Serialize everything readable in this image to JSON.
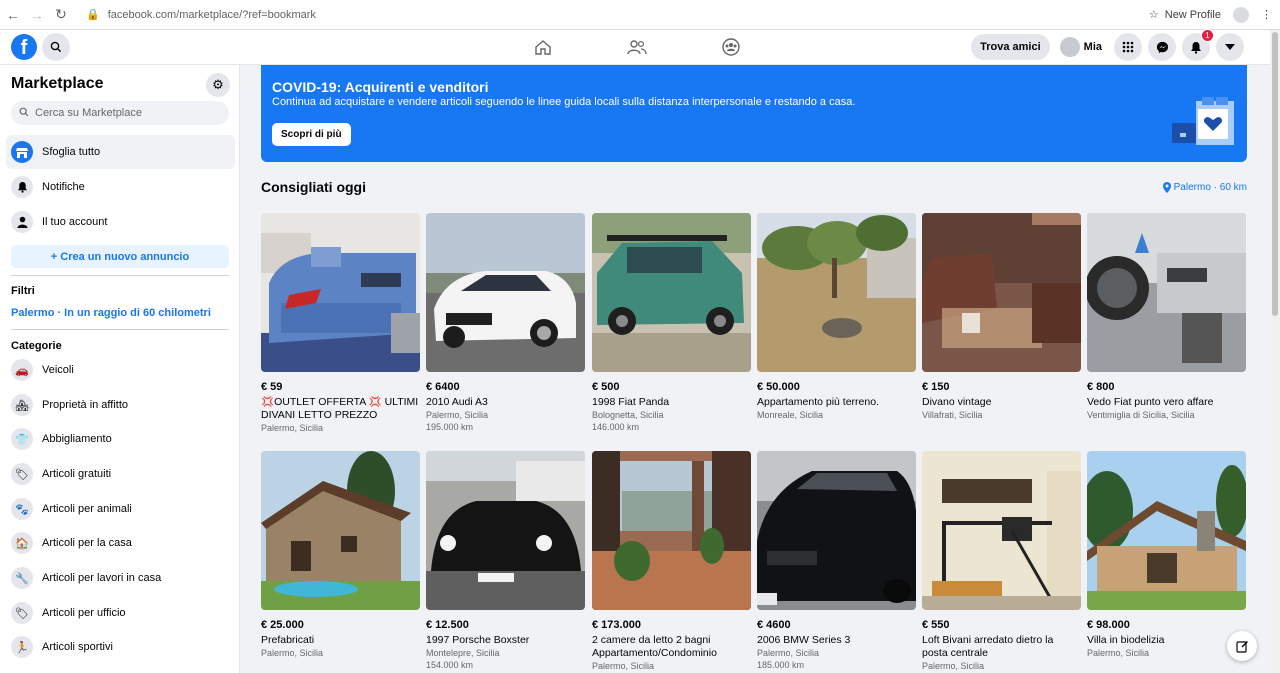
{
  "browser": {
    "url": "facebook.com/marketplace/?ref=bookmark",
    "profile_label": "New Profile"
  },
  "topbar": {
    "find_friends": "Trova amici",
    "user_name": "Mia",
    "notif_count": "1"
  },
  "sidebar": {
    "title": "Marketplace",
    "search_placeholder": "Cerca su Marketplace",
    "nav": [
      {
        "label": "Sfoglia tutto",
        "icon": "shop-icon"
      },
      {
        "label": "Notifiche",
        "icon": "bell-icon"
      },
      {
        "label": "Il tuo account",
        "icon": "person-icon"
      }
    ],
    "create_label": "+ Crea un nuovo annuncio",
    "filters_title": "Filtri",
    "filter_value": "Palermo · In un raggio di 60 chilometri",
    "categories_title": "Categorie",
    "categories": [
      {
        "label": "Veicoli",
        "icon": "car-icon"
      },
      {
        "label": "Proprietà in affitto",
        "icon": "house-key-icon"
      },
      {
        "label": "Abbigliamento",
        "icon": "shirt-icon"
      },
      {
        "label": "Articoli gratuiti",
        "icon": "tag-icon"
      },
      {
        "label": "Articoli per animali",
        "icon": "paw-icon"
      },
      {
        "label": "Articoli per la casa",
        "icon": "home-icon"
      },
      {
        "label": "Articoli per lavori in casa",
        "icon": "wrench-icon"
      },
      {
        "label": "Articoli per ufficio",
        "icon": "tags-icon"
      },
      {
        "label": "Articoli sportivi",
        "icon": "running-icon"
      }
    ]
  },
  "banner": {
    "title": "COVID-19: Acquirenti e venditori",
    "text": "Continua ad acquistare e vendere articoli seguendo le linee guida locali sulla distanza interpersonale e restando a casa.",
    "button": "Scopri di più"
  },
  "section": {
    "title": "Consigliati oggi",
    "location": "Palermo · 60 km"
  },
  "listings": [
    {
      "price": "€ 59",
      "title": "💢OUTLET OFFERTA 💢 ULTIMI DIVANI LETTO PREZZO STOCK...",
      "place": "Palermo, Sicilia",
      "km": "",
      "photo": "sofa-blue"
    },
    {
      "price": "€ 6400",
      "title": "2010 Audi A3",
      "place": "Palermo, Sicilia",
      "km": "195.000 km",
      "photo": "car-white"
    },
    {
      "price": "€ 500",
      "title": "1998 Fiat Panda",
      "place": "Bolognetta, Sicilia",
      "km": "146.000 km",
      "photo": "car-green"
    },
    {
      "price": "€ 50.000",
      "title": "Appartamento più terreno.",
      "place": "Monreale, Sicilia",
      "km": "",
      "photo": "land"
    },
    {
      "price": "€ 150",
      "title": "Divano vintage",
      "place": "Villafrati, Sicilia",
      "km": "",
      "photo": "sofa-brown"
    },
    {
      "price": "€ 800",
      "title": "Vedo Fiat punto vero affare",
      "place": "Ventimiglia di Sicilia, Sicilia",
      "km": "",
      "photo": "car-interior"
    },
    {
      "price": "€ 25.000",
      "title": "Prefabricati",
      "place": "Palermo, Sicilia",
      "km": "",
      "photo": "stone-house"
    },
    {
      "price": "€ 12.500",
      "title": "1997 Porsche Boxster",
      "place": "Montelepre, Sicilia",
      "km": "154.000 km",
      "photo": "car-black"
    },
    {
      "price": "€ 173.000",
      "title": "2 camere da letto 2 bagni Appartamento/Condominio",
      "place": "Palermo, Sicilia",
      "km": "",
      "photo": "balcony"
    },
    {
      "price": "€ 4600",
      "title": "2006 BMW Series 3",
      "place": "Palermo, Sicilia",
      "km": "185.000 km",
      "photo": "car-bmw"
    },
    {
      "price": "€ 550",
      "title": "Loft Bivani arredato dietro la posta centrale",
      "place": "Palermo, Sicilia",
      "km": "",
      "photo": "loft"
    },
    {
      "price": "€ 98.000",
      "title": "Villa in biodelizia",
      "place": "Palermo, Sicilia",
      "km": "",
      "photo": "villa"
    }
  ]
}
